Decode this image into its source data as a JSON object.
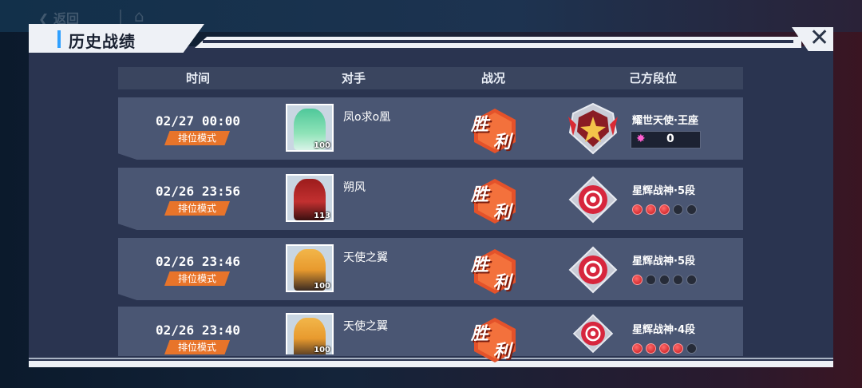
{
  "ghost_nav": {
    "back_label": "返回"
  },
  "title": "历史战绩",
  "columns": [
    "时间",
    "对手",
    "战况",
    "己方段位"
  ],
  "colors": {
    "accent": "#2fa0ff",
    "mode_badge": "#e8742a",
    "win": "#e4522a",
    "rank_dot_on": "#c4161c"
  },
  "rows": [
    {
      "time": "02/27 00:00",
      "mode": "排位模式",
      "opponent": "凤o求o凰",
      "level": "100",
      "result_a": "胜",
      "result_b": "利",
      "rank": "耀世天使·王座",
      "score": "0",
      "dots_on": null
    },
    {
      "time": "02/26 23:56",
      "mode": "排位模式",
      "opponent": "朔风",
      "level": "113",
      "result_a": "胜",
      "result_b": "利",
      "rank": "星辉战神·5段",
      "score": null,
      "dots_on": 3
    },
    {
      "time": "02/26 23:46",
      "mode": "排位模式",
      "opponent": "天使之翼",
      "level": "100",
      "result_a": "胜",
      "result_b": "利",
      "rank": "星辉战神·5段",
      "score": null,
      "dots_on": 1
    },
    {
      "time": "02/26 23:40",
      "mode": "排位模式",
      "opponent": "天使之翼",
      "level": "100",
      "result_a": "胜",
      "result_b": "利",
      "rank": "星辉战神·4段",
      "score": null,
      "dots_on": 4
    }
  ]
}
